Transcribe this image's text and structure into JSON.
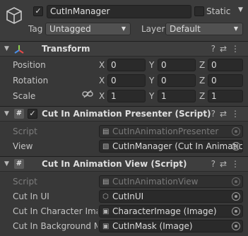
{
  "gameobject": {
    "active": true,
    "name": "CutInManager",
    "static_label": "Static",
    "static_checked": false,
    "tag_label": "Tag",
    "tag_value": "Untagged",
    "layer_label": "Layer",
    "layer_value": "Default"
  },
  "transform": {
    "title": "Transform",
    "rows": [
      {
        "label": "Position",
        "x": "0",
        "y": "0",
        "z": "0"
      },
      {
        "label": "Rotation",
        "x": "0",
        "y": "0",
        "z": "0"
      },
      {
        "label": "Scale",
        "x": "1",
        "y": "1",
        "z": "1"
      }
    ],
    "axis_x": "X",
    "axis_y": "Y",
    "axis_z": "Z"
  },
  "presenter": {
    "title": "Cut In Animation Presenter (Script)",
    "enabled": true,
    "script_label": "Script",
    "script_value": "CutInAnimationPresenter",
    "view_label": "View",
    "view_value": "CutInManager (Cut In Animatic"
  },
  "view_component": {
    "title": "Cut In Animation View (Script)",
    "script_label": "Script",
    "script_value": "CutInAnimationView",
    "fields": [
      {
        "label": "Cut In UI",
        "value": "CutInUI"
      },
      {
        "label": "Cut In Character Imag",
        "value": "CharacterImage (Image)"
      },
      {
        "label": "Cut In Background M",
        "value": "CutInMask (Image)"
      }
    ]
  },
  "icons": {
    "gameobject": "cube-icon",
    "transform": "transform-axes-icon",
    "script": "script-hash-icon",
    "help": "help-icon",
    "presets": "presets-icon",
    "menu": "kebab-menu-icon",
    "link": "constrain-proportions-icon",
    "picker": "object-picker-icon"
  }
}
